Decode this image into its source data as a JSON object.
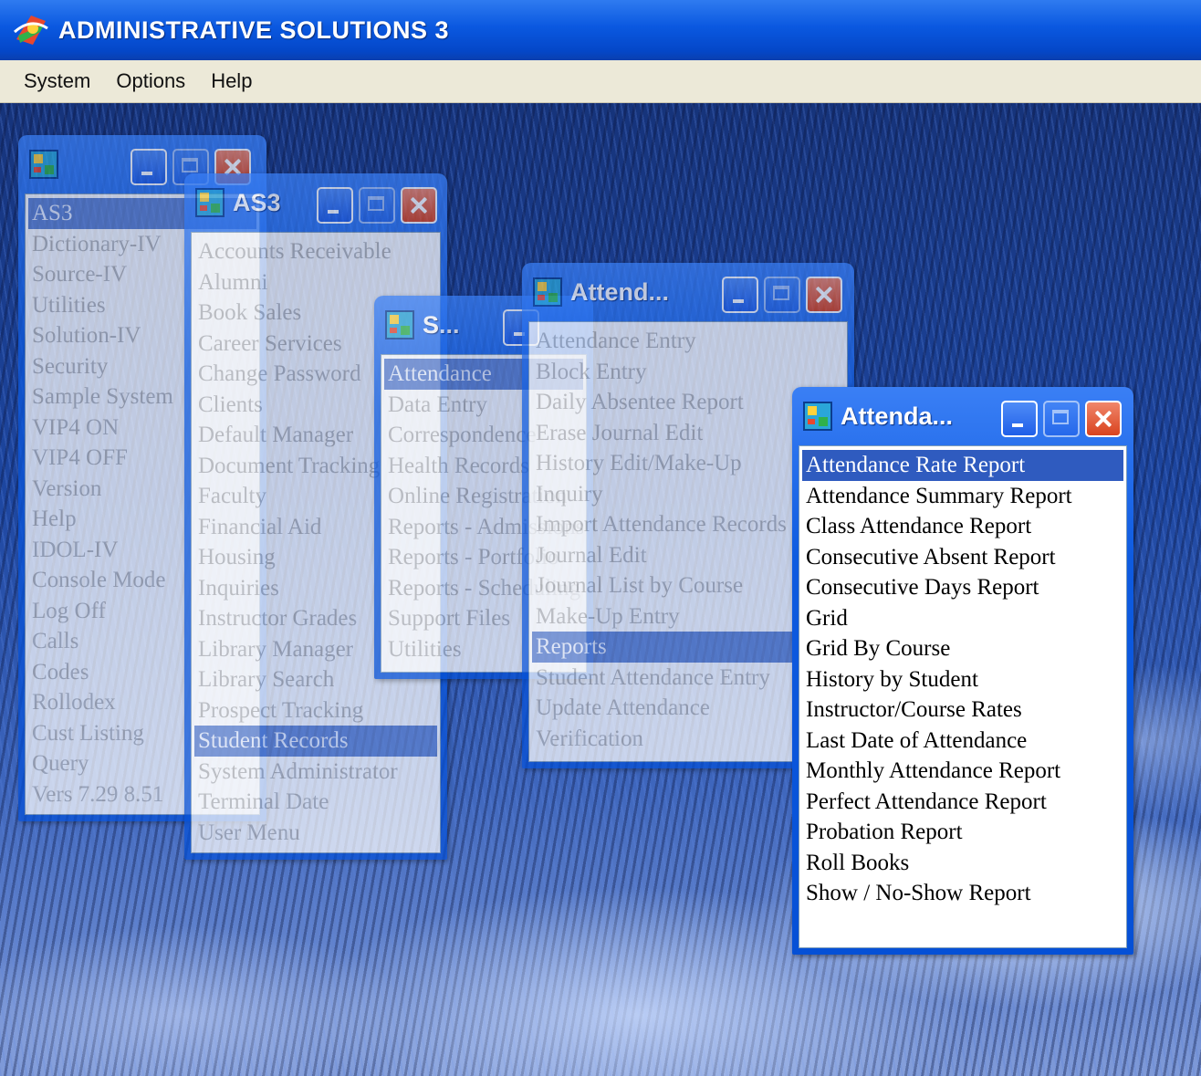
{
  "app": {
    "title": "ADMINISTRATIVE SOLUTIONS 3",
    "menu": [
      "System",
      "Options",
      "Help"
    ]
  },
  "windows": {
    "main": {
      "caption": "",
      "items": [
        "AS3",
        "Dictionary-IV",
        "Source-IV",
        "Utilities",
        "Solution-IV",
        "Security",
        "Sample System",
        "VIP4 ON",
        "VIP4 OFF",
        "Version",
        "Help",
        "IDOL-IV",
        "Console Mode",
        "Log Off",
        "Calls",
        "Codes",
        "Rollodex",
        "Cust Listing",
        "Query",
        "Vers 7.29 8.51"
      ],
      "selected": "AS3"
    },
    "as3": {
      "caption": "AS3",
      "items": [
        "Accounts Receivable",
        "Alumni",
        "Book Sales",
        "Career Services",
        "Change Password",
        "Clients",
        "Default Manager",
        "Document Tracking",
        "Faculty",
        "Financial Aid",
        "Housing",
        "Inquiries",
        "Instructor Grades",
        "Library Manager",
        "Library Search",
        "Prospect Tracking",
        "Student Records",
        "System Administrator",
        "Terminal Date",
        "User Menu"
      ],
      "selected": "Student Records"
    },
    "student": {
      "caption": "S...",
      "items": [
        "Attendance",
        "Data Entry",
        "Correspondence",
        "Health Records",
        "Online Registration",
        "Reports - Admissions",
        "Reports - Portfolio",
        "Reports - Scheduling",
        "Support Files",
        "Utilities"
      ],
      "selected": "Attendance"
    },
    "attend1": {
      "caption": "Attend...",
      "items": [
        "Attendance Entry",
        "Block Entry",
        "Daily Absentee Report",
        "Erase Journal Edit",
        "History Edit/Make-Up",
        "Inquiry",
        "Import Attendance Records",
        "Journal Edit",
        "Journal List by Course",
        "Make-Up Entry",
        "Reports",
        "Student Attendance Entry",
        "Update Attendance",
        "Verification"
      ],
      "selected": "Reports"
    },
    "attend2": {
      "caption": "Attenda...",
      "items": [
        "Attendance Rate Report",
        "Attendance Summary Report",
        "Class Attendance Report",
        "Consecutive Absent Report",
        "Consecutive Days Report",
        "Grid",
        "Grid By Course",
        "History by Student",
        "Instructor/Course Rates",
        "Last Date of Attendance",
        "Monthly Attendance Report",
        "Perfect Attendance Report",
        "Probation Report",
        "Roll Books",
        "Show / No-Show Report"
      ],
      "selected": "Attendance Rate Report"
    }
  },
  "icons": {
    "app_logo": "as3-logo-icon",
    "window_icon": "as3-window-icon",
    "minimize": "minimize-icon",
    "maximize": "maximize-icon",
    "close": "close-icon"
  },
  "colors": {
    "titlebar": "#0a58e0",
    "selection": "#2f5bbf",
    "close_button": "#d9431e",
    "menubar": "#ece9d8"
  }
}
